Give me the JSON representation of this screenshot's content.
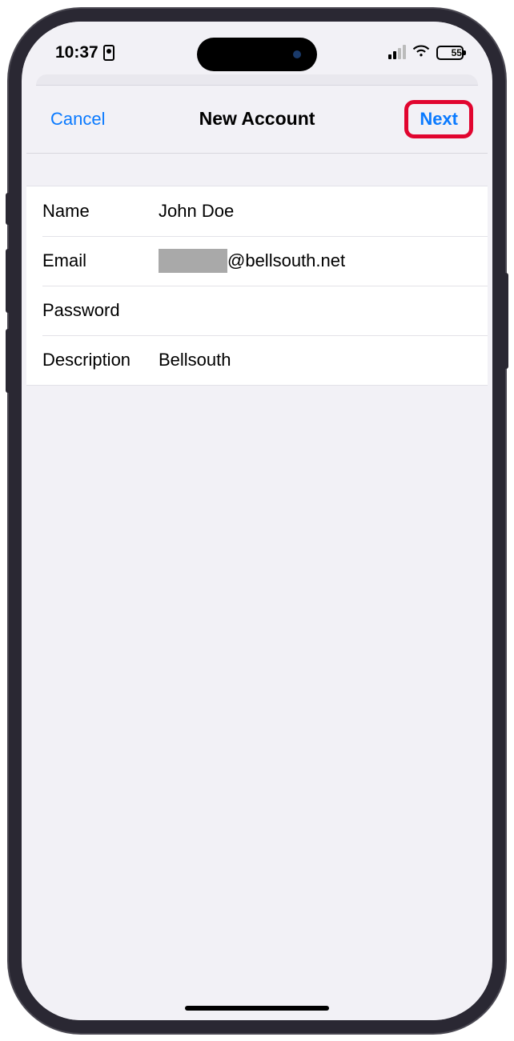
{
  "status": {
    "time": "10:37",
    "battery": "55"
  },
  "nav": {
    "cancel": "Cancel",
    "title": "New Account",
    "next": "Next"
  },
  "form": {
    "name_label": "Name",
    "name_value": "John Doe",
    "email_label": "Email",
    "email_suffix": "@bellsouth.net",
    "password_label": "Password",
    "password_value": "",
    "description_label": "Description",
    "description_value": "Bellsouth"
  }
}
